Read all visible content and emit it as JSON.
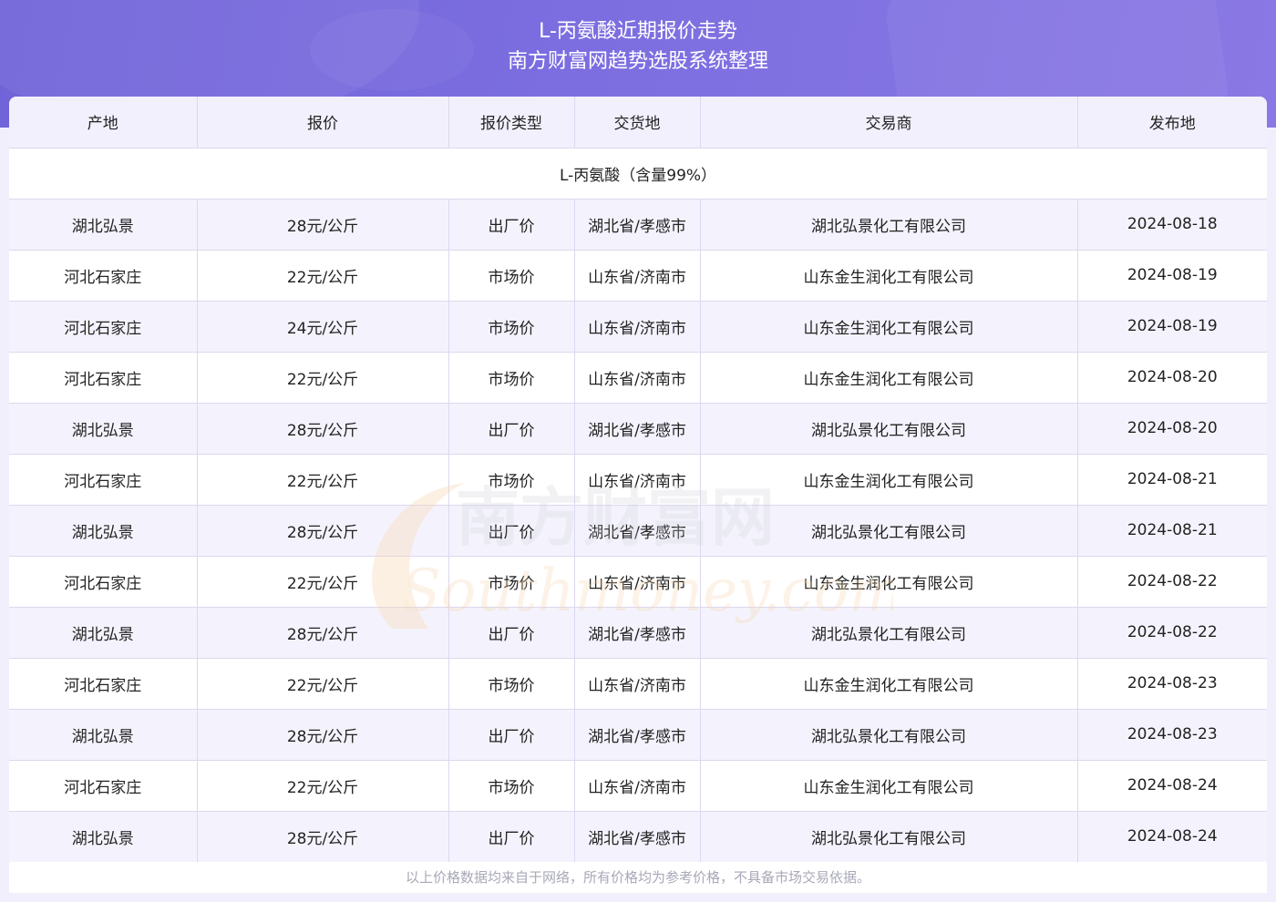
{
  "header": {
    "title_line1": "L-丙氨酸近期报价走势",
    "title_line2": "南方财富网趋势选股系统整理"
  },
  "table": {
    "columns": [
      "产地",
      "报价",
      "报价类型",
      "交货地",
      "交易商",
      "发布地"
    ],
    "group_label": "L-丙氨酸（含量99%）",
    "rows": [
      [
        "湖北弘景",
        "28元/公斤",
        "出厂价",
        "湖北省/孝感市",
        "湖北弘景化工有限公司",
        "2024-08-18"
      ],
      [
        "河北石家庄",
        "22元/公斤",
        "市场价",
        "山东省/济南市",
        "山东金生润化工有限公司",
        "2024-08-19"
      ],
      [
        "河北石家庄",
        "24元/公斤",
        "市场价",
        "山东省/济南市",
        "山东金生润化工有限公司",
        "2024-08-19"
      ],
      [
        "河北石家庄",
        "22元/公斤",
        "市场价",
        "山东省/济南市",
        "山东金生润化工有限公司",
        "2024-08-20"
      ],
      [
        "湖北弘景",
        "28元/公斤",
        "出厂价",
        "湖北省/孝感市",
        "湖北弘景化工有限公司",
        "2024-08-20"
      ],
      [
        "河北石家庄",
        "22元/公斤",
        "市场价",
        "山东省/济南市",
        "山东金生润化工有限公司",
        "2024-08-21"
      ],
      [
        "湖北弘景",
        "28元/公斤",
        "出厂价",
        "湖北省/孝感市",
        "湖北弘景化工有限公司",
        "2024-08-21"
      ],
      [
        "河北石家庄",
        "22元/公斤",
        "市场价",
        "山东省/济南市",
        "山东金生润化工有限公司",
        "2024-08-22"
      ],
      [
        "湖北弘景",
        "28元/公斤",
        "出厂价",
        "湖北省/孝感市",
        "湖北弘景化工有限公司",
        "2024-08-22"
      ],
      [
        "河北石家庄",
        "22元/公斤",
        "市场价",
        "山东省/济南市",
        "山东金生润化工有限公司",
        "2024-08-23"
      ],
      [
        "湖北弘景",
        "28元/公斤",
        "出厂价",
        "湖北省/孝感市",
        "湖北弘景化工有限公司",
        "2024-08-23"
      ],
      [
        "河北石家庄",
        "22元/公斤",
        "市场价",
        "山东省/济南市",
        "山东金生润化工有限公司",
        "2024-08-24"
      ],
      [
        "湖北弘景",
        "28元/公斤",
        "出厂价",
        "湖北省/孝感市",
        "湖北弘景化工有限公司",
        "2024-08-24"
      ]
    ]
  },
  "footer": {
    "disclaimer": "以上价格数据均来自于网络，所有价格均为参考价格，不具备市场交易依据。"
  },
  "watermark": {
    "text_cn": "南方财富网",
    "text_en": "Southmoney.com"
  },
  "colors": {
    "header_start": "#6f63d8",
    "header_end": "#8a79e4",
    "row_alt": "#f4f3fd",
    "border": "#dcd8ef",
    "watermark": "#f5d9b8"
  }
}
